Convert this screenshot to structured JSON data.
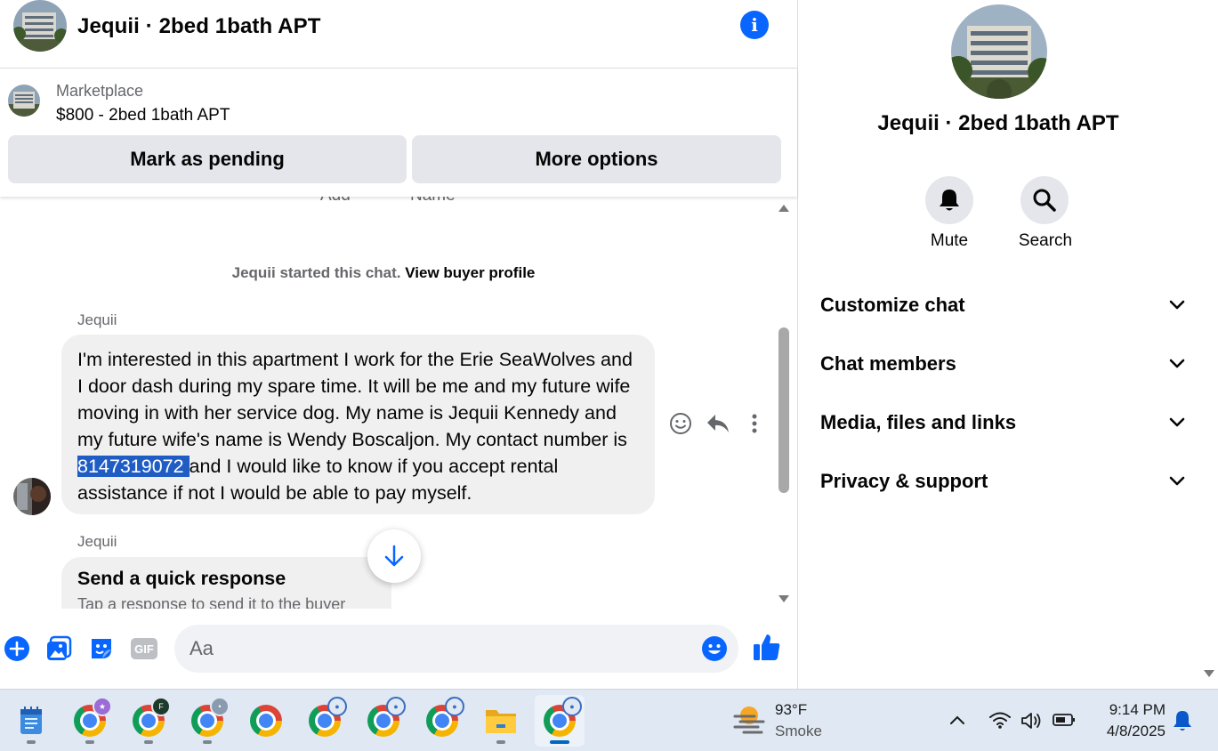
{
  "colors": {
    "accent": "#0866ff",
    "bubble": "#f0f0f0",
    "button_gray": "#e4e6eb",
    "highlight": "#1f5dc5",
    "taskbar": "#dfe8f3"
  },
  "header": {
    "title": "Jequii · 2bed 1bath APT",
    "info_icon": "info-icon"
  },
  "marketplace": {
    "label": "Marketplace",
    "price_title": "$800 - 2bed 1bath APT",
    "mark_pending": "Mark as pending",
    "more_options": "More options"
  },
  "messages": {
    "cut_label_1": "Add",
    "cut_label_2": "Name",
    "started_text": "Jequii started this chat.",
    "view_profile": "View buyer profile",
    "sender_1": "Jequii",
    "message_before": "I'm interested in this apartment I work for the Erie SeaWolves and I door dash during my spare time. It will be me and my future wife moving in with her service dog. My name is Jequii Kennedy and my future wife's name is Wendy Boscaljon. My contact number is ",
    "message_phone": "8147319072 ",
    "message_after": "and I would like to know if you accept rental assistance if not I would be able to pay myself.",
    "sender_2": "Jequii",
    "quick_title": "Send a quick response",
    "quick_sub": "Tap a response to send it to the buyer"
  },
  "composer": {
    "placeholder": "Aa"
  },
  "side": {
    "title": "Jequii · 2bed 1bath APT",
    "mute": "Mute",
    "search": "Search",
    "sections": [
      "Customize chat",
      "Chat members",
      "Media, files and links",
      "Privacy & support"
    ]
  },
  "taskbar": {
    "weather_temp": "93°F",
    "weather_desc": "Smoke",
    "time": "9:14 PM",
    "date": "4/8/2025"
  }
}
